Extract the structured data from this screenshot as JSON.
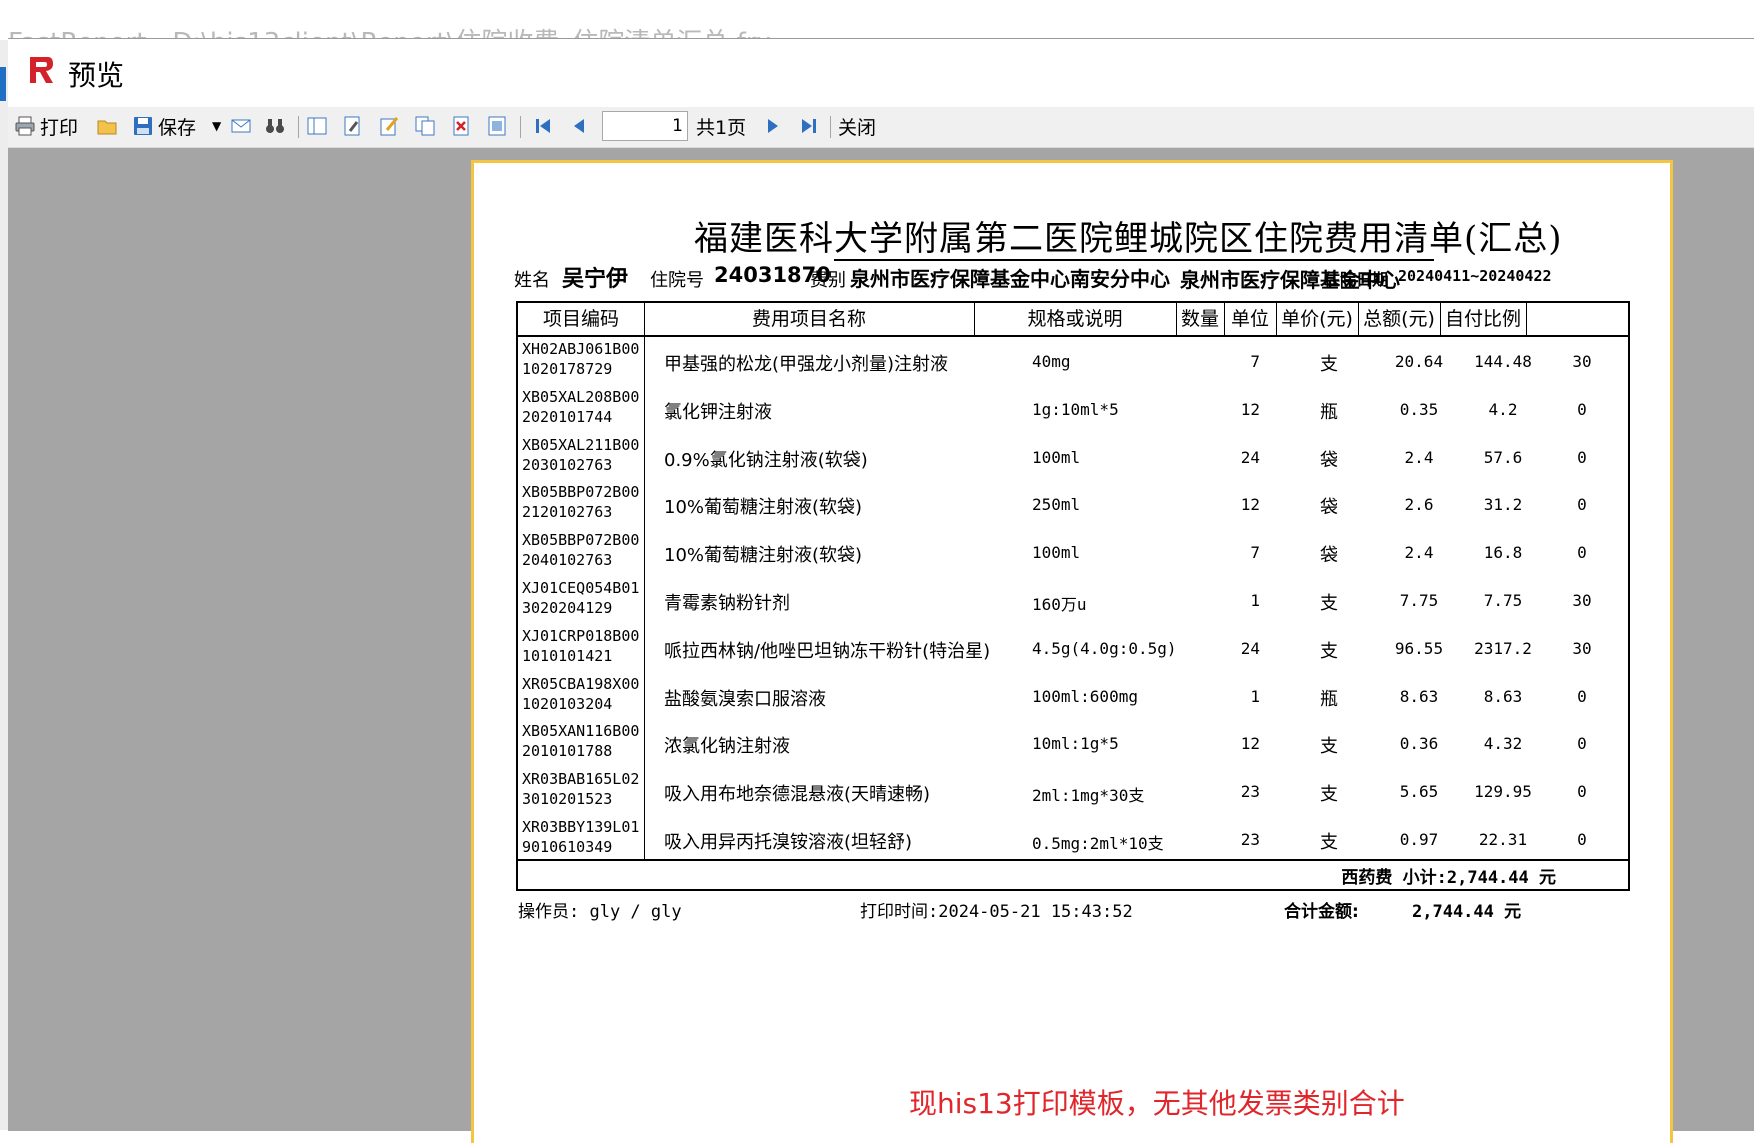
{
  "background": {
    "title": "FastReport - D:\\his13client\\Report\\住院收费_住院清单汇总.frx"
  },
  "window": {
    "title": "预览"
  },
  "toolbar": {
    "print_label": "打印",
    "save_label": "保存",
    "page_value": "1",
    "page_total": "共1页",
    "close_label": "关闭"
  },
  "report": {
    "title": "福建医科大学附属第二医院鲤城院区住院费用清单(汇总)",
    "name_label": "姓名",
    "patient_name": "吴宁伊",
    "admission_label": "住院号",
    "admission_no": "24031870",
    "fee_type_label": "费别",
    "fee_type": "泉州市医疗保障基金中心南安分中心",
    "overlap_text": "泉州市医疗保障基金中心",
    "period_label": "住院日期",
    "period": "20240411~20240422",
    "columns": [
      "项目编码",
      "费用项目名称",
      "规格或说明",
      "数量",
      "单位",
      "单价(元)",
      "总额(元)",
      "自付比例"
    ],
    "rows": [
      {
        "code1": "XH02ABJ061B00",
        "code2": "1020178729",
        "name": "甲基强的松龙(甲强龙小剂量)注射液",
        "spec": "40mg",
        "qty": "7",
        "unit": "支",
        "price": "20.64",
        "amount": "144.48",
        "ratio": "30"
      },
      {
        "code1": "XB05XAL208B00",
        "code2": "2020101744",
        "name": "氯化钾注射液",
        "spec": "1g:10ml*5",
        "qty": "12",
        "unit": "瓶",
        "price": "0.35",
        "amount": "4.2",
        "ratio": "0"
      },
      {
        "code1": "XB05XAL211B00",
        "code2": "2030102763",
        "name": "0.9%氯化钠注射液(软袋)",
        "spec": "100ml",
        "qty": "24",
        "unit": "袋",
        "price": "2.4",
        "amount": "57.6",
        "ratio": "0"
      },
      {
        "code1": "XB05BBP072B00",
        "code2": "2120102763",
        "name": "10%葡萄糖注射液(软袋)",
        "spec": "250ml",
        "qty": "12",
        "unit": "袋",
        "price": "2.6",
        "amount": "31.2",
        "ratio": "0"
      },
      {
        "code1": "XB05BBP072B00",
        "code2": "2040102763",
        "name": "10%葡萄糖注射液(软袋)",
        "spec": "100ml",
        "qty": "7",
        "unit": "袋",
        "price": "2.4",
        "amount": "16.8",
        "ratio": "0"
      },
      {
        "code1": "XJ01CEQ054B01",
        "code2": "3020204129",
        "name": "青霉素钠粉针剂",
        "spec": "160万u",
        "qty": "1",
        "unit": "支",
        "price": "7.75",
        "amount": "7.75",
        "ratio": "30"
      },
      {
        "code1": "XJ01CRP018B00",
        "code2": "1010101421",
        "name": "哌拉西林钠/他唑巴坦钠冻干粉针(特治星)",
        "spec": "4.5g(4.0g:0.5g)",
        "qty": "24",
        "unit": "支",
        "price": "96.55",
        "amount": "2317.2",
        "ratio": "30"
      },
      {
        "code1": "XR05CBA198X00",
        "code2": "1020103204",
        "name": "盐酸氨溴索口服溶液",
        "spec": "100ml:600mg",
        "qty": "1",
        "unit": "瓶",
        "price": "8.63",
        "amount": "8.63",
        "ratio": "0"
      },
      {
        "code1": "XB05XAN116B00",
        "code2": "2010101788",
        "name": "浓氯化钠注射液",
        "spec": "10ml:1g*5",
        "qty": "12",
        "unit": "支",
        "price": "0.36",
        "amount": "4.32",
        "ratio": "0"
      },
      {
        "code1": "XR03BAB165L02",
        "code2": "3010201523",
        "name": "吸入用布地奈德混悬液(天晴速畅)",
        "spec": "2ml:1mg*30支",
        "qty": "23",
        "unit": "支",
        "price": "5.65",
        "amount": "129.95",
        "ratio": "0"
      },
      {
        "code1": "XR03BBY139L01",
        "code2": "9010610349",
        "name": "吸入用异丙托溴铵溶液(坦轻舒)",
        "spec": "0.5mg:2ml*10支",
        "qty": "23",
        "unit": "支",
        "price": "0.97",
        "amount": "22.31",
        "ratio": "0"
      }
    ],
    "subtotal": "西药费 小计:2,744.44  元",
    "operator": "操作员: gly / gly",
    "print_time": "打印时间:2024-05-21 15:43:52",
    "total_label": "合计金额:",
    "total_value": "2,744.44 元"
  },
  "annotation": "现his13打印模板，无其他发票类别合计"
}
